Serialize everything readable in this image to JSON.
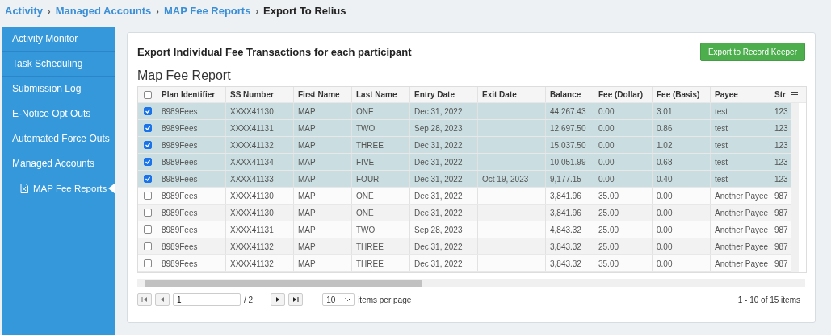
{
  "breadcrumb": [
    {
      "kind": "link",
      "label": "Activity"
    },
    {
      "kind": "separator",
      "label": "›"
    },
    {
      "kind": "link",
      "label": "Managed Accounts"
    },
    {
      "kind": "separator",
      "label": "›"
    },
    {
      "kind": "link",
      "label": "MAP Fee Reports"
    },
    {
      "kind": "separator",
      "label": "›"
    },
    {
      "kind": "current",
      "label": "Export To Relius"
    }
  ],
  "sidebar": {
    "items": [
      {
        "label": "Activity Monitor",
        "selected": false
      },
      {
        "label": "Task Scheduling",
        "selected": false
      },
      {
        "label": "Submission Log",
        "selected": false
      },
      {
        "label": "E-Notice Opt Outs",
        "selected": false
      },
      {
        "label": "Automated Force Outs",
        "selected": false
      },
      {
        "label": "Managed Accounts",
        "selected": false,
        "children": [
          {
            "label": "MAP Fee Reports",
            "selected": true
          }
        ]
      }
    ]
  },
  "panel": {
    "heading": "Export Individual Fee Transactions for each participant",
    "export_button": "Export to Record Keeper",
    "report_title": "Map Fee Report"
  },
  "table": {
    "select_all": {
      "checked": false
    },
    "columns": [
      "Plan Identifier",
      "SS Number",
      "First Name",
      "Last Name",
      "Entry Date",
      "Exit Date",
      "Balance",
      "Fee (Dollar)",
      "Fee (Basis)",
      "Payee",
      "Str"
    ],
    "rows": [
      {
        "selected": true,
        "cells": [
          "8989Fees",
          "XXXX41130",
          "MAP",
          "ONE",
          "Dec 31, 2022",
          "",
          "44,267.43",
          "0.00",
          "3.01",
          "test",
          "123"
        ]
      },
      {
        "selected": true,
        "cells": [
          "8989Fees",
          "XXXX41131",
          "MAP",
          "TWO",
          "Sep 28, 2023",
          "",
          "12,697.50",
          "0.00",
          "0.86",
          "test",
          "123"
        ]
      },
      {
        "selected": true,
        "cells": [
          "8989Fees",
          "XXXX41132",
          "MAP",
          "THREE",
          "Dec 31, 2022",
          "",
          "15,037.50",
          "0.00",
          "1.02",
          "test",
          "123"
        ]
      },
      {
        "selected": true,
        "cells": [
          "8989Fees",
          "XXXX41134",
          "MAP",
          "FIVE",
          "Dec 31, 2022",
          "",
          "10,051.99",
          "0.00",
          "0.68",
          "test",
          "123"
        ]
      },
      {
        "selected": true,
        "cells": [
          "8989Fees",
          "XXXX41133",
          "MAP",
          "FOUR",
          "Dec 31, 2022",
          "Oct 19, 2023",
          "9,177.15",
          "0.00",
          "0.40",
          "test",
          "123"
        ]
      },
      {
        "selected": false,
        "cells": [
          "8989Fees",
          "XXXX41130",
          "MAP",
          "ONE",
          "Dec 31, 2022",
          "",
          "3,841.96",
          "35.00",
          "0.00",
          "Another Payee",
          "987"
        ]
      },
      {
        "selected": false,
        "cells": [
          "8989Fees",
          "XXXX41130",
          "MAP",
          "ONE",
          "Dec 31, 2022",
          "",
          "3,841.96",
          "25.00",
          "0.00",
          "Another Payee",
          "987"
        ]
      },
      {
        "selected": false,
        "cells": [
          "8989Fees",
          "XXXX41131",
          "MAP",
          "TWO",
          "Sep 28, 2023",
          "",
          "4,843.32",
          "25.00",
          "0.00",
          "Another Payee",
          "987"
        ]
      },
      {
        "selected": false,
        "cells": [
          "8989Fees",
          "XXXX41132",
          "MAP",
          "THREE",
          "Dec 31, 2022",
          "",
          "3,843.32",
          "25.00",
          "0.00",
          "Another Payee",
          "987"
        ]
      },
      {
        "selected": false,
        "cells": [
          "8989Fees",
          "XXXX41132",
          "MAP",
          "THREE",
          "Dec 31, 2022",
          "",
          "3,843.32",
          "35.00",
          "0.00",
          "Another Payee",
          "987"
        ]
      }
    ]
  },
  "pager": {
    "page": "1",
    "page_count": "/ 2",
    "page_size": "10",
    "page_size_label": "items per page",
    "summary": "1 - 10 of 15 items"
  }
}
